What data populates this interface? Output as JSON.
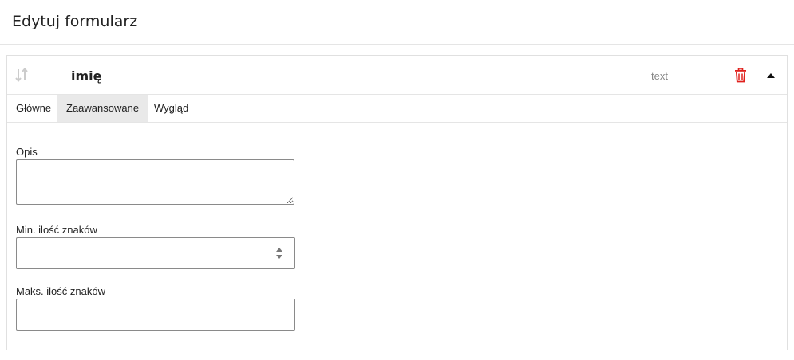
{
  "page": {
    "title": "Edytuj formularz"
  },
  "field": {
    "name": "imię",
    "type": "text",
    "icons": {
      "drag": "sort-arrows-icon",
      "delete": "trash-icon",
      "collapse": "caret-up-icon"
    },
    "colors": {
      "delete": "#e0201c",
      "drag": "#cccccc"
    }
  },
  "tabs": [
    {
      "label": "Główne",
      "active": false
    },
    {
      "label": "Zaawansowane",
      "active": true
    },
    {
      "label": "Wygląd",
      "active": false
    }
  ],
  "form": {
    "opis": {
      "label": "Opis",
      "value": ""
    },
    "min_chars": {
      "label": "Min. ilość znaków",
      "value": ""
    },
    "max_chars": {
      "label": "Maks. ilość znaków",
      "value": ""
    }
  }
}
